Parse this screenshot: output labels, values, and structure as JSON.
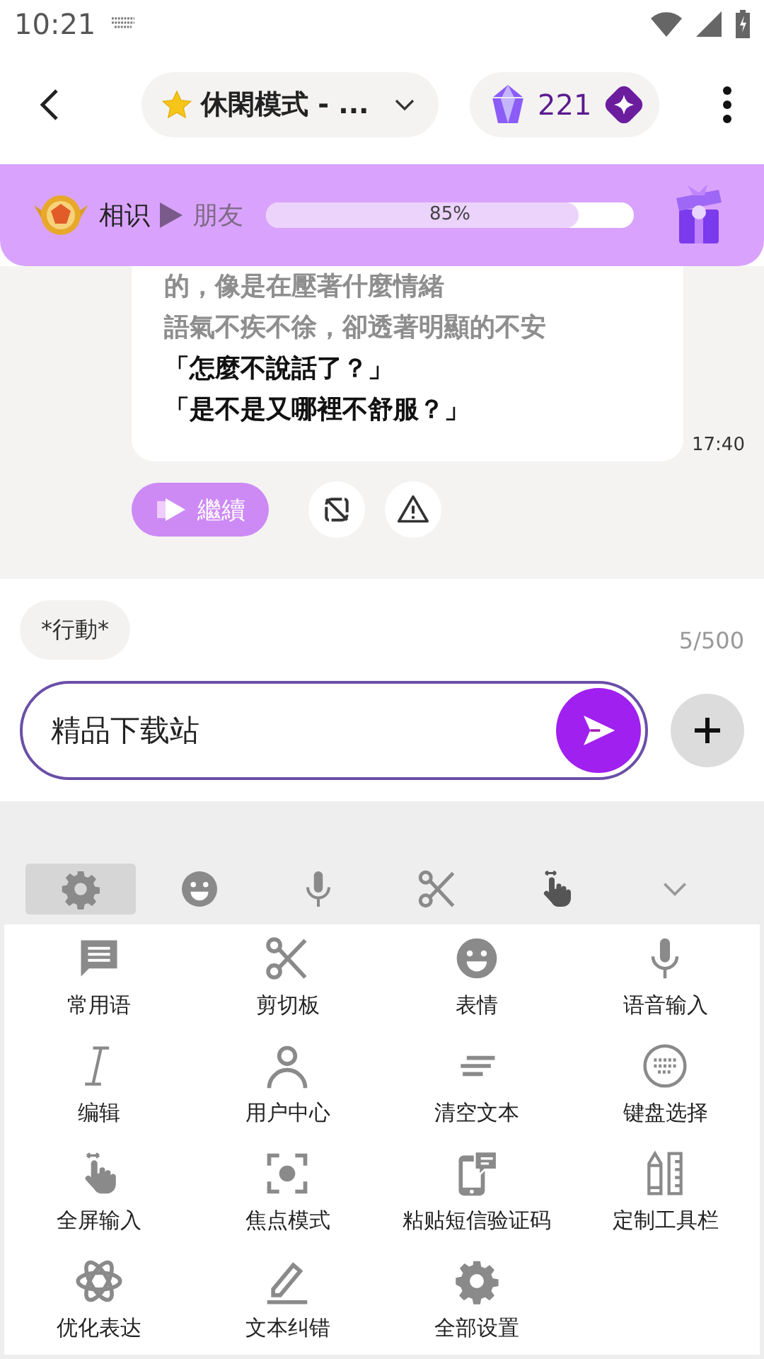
{
  "status_bar": {
    "time": "10:21"
  },
  "header": {
    "mode": "休閑模式 - ...",
    "gems": "221"
  },
  "relationship": {
    "current": "相识",
    "next": "朋友",
    "level": 0.85,
    "reading": "85%"
  },
  "message": {
    "lines": [
      {
        "kind": "narration",
        "text": "的，像是在壓著什麼情緒"
      },
      {
        "kind": "narration",
        "text": "語氣不疾不徐，卻透著明顯的不安"
      },
      {
        "kind": "dialogue",
        "text": "「怎麼不說話了？」"
      },
      {
        "kind": "dialogue",
        "text": "「是不是又哪裡不舒服？」"
      }
    ],
    "time": "17:40",
    "continue_label": "繼續"
  },
  "composer": {
    "chip": "*行動*",
    "counter": "5/500",
    "value": "精品下载站"
  },
  "keyboard_toolbar": [
    {
      "selected": true
    },
    {
      "selected": false
    },
    {
      "selected": false
    },
    {
      "selected": false
    },
    {
      "selected": false
    }
  ],
  "tools": [
    {
      "label": "常用语"
    },
    {
      "label": "剪切板"
    },
    {
      "label": "表情"
    },
    {
      "label": "语音输入"
    },
    {
      "label": "编辑"
    },
    {
      "label": "用户中心"
    },
    {
      "label": "清空文本"
    },
    {
      "label": "键盘选择"
    },
    {
      "label": "全屏输入"
    },
    {
      "label": "焦点模式"
    },
    {
      "label": "粘贴短信验证码"
    },
    {
      "label": "定制工具栏"
    },
    {
      "label": "优化表达"
    },
    {
      "label": "文本纠错"
    },
    {
      "label": "全部设置"
    }
  ]
}
